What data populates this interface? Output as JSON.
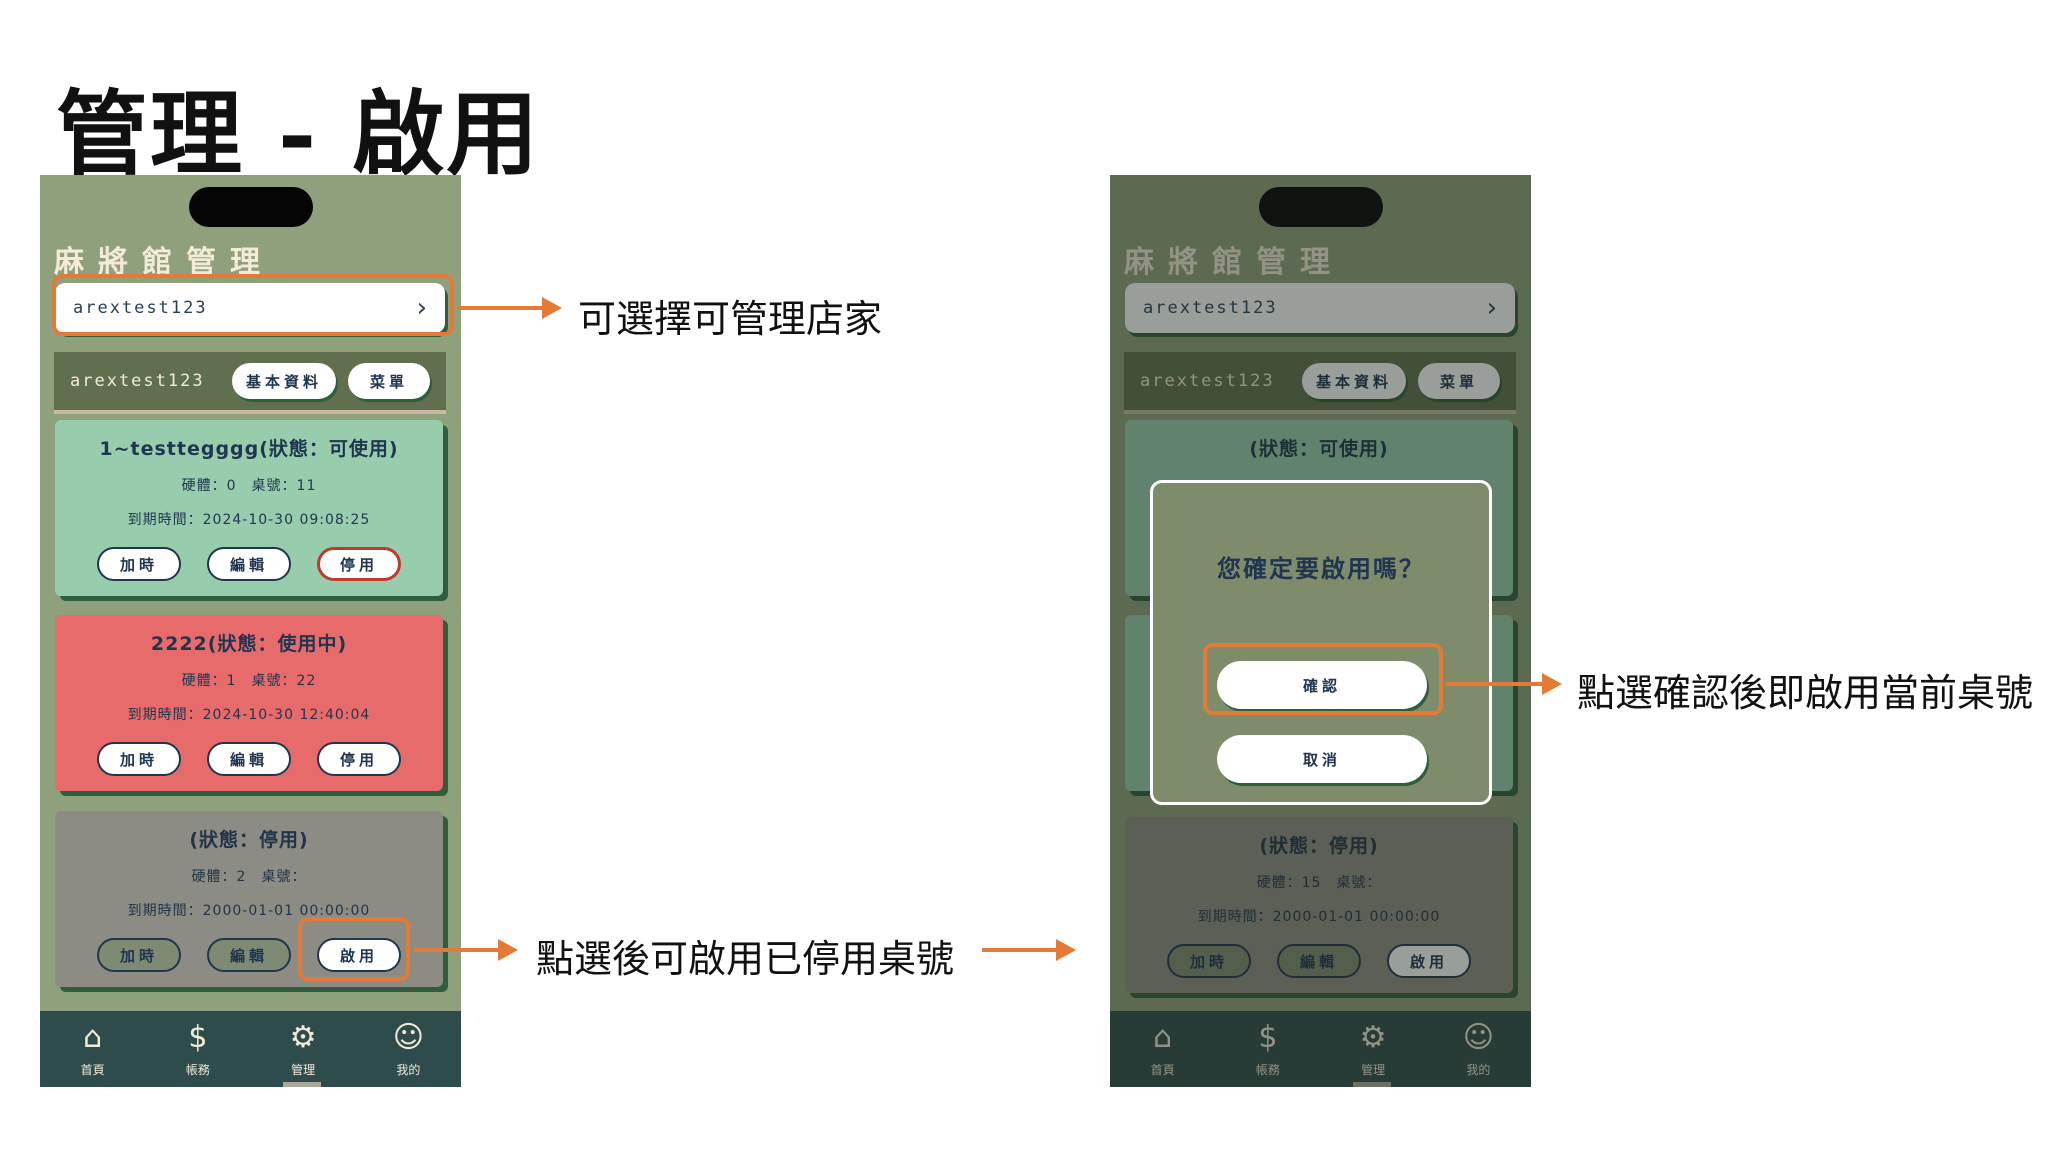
{
  "slide_title": "管理 - 啟用",
  "app_title": "麻將館管理",
  "shop_selector": {
    "value": "arextest123"
  },
  "store_bar": {
    "name": "arextest123",
    "basic_label": "基本資料",
    "menu_label": "菜單"
  },
  "tables": [
    {
      "heading": "1~testtegggg(狀態：可使用)",
      "hardware": "硬體：0　桌號：11",
      "expiry": "到期時間：2024-10-30 09:08:25",
      "buttons": [
        "加時",
        "編輯",
        "停用"
      ]
    },
    {
      "heading": "2222(狀態：使用中)",
      "hardware": "硬體：1　桌號：22",
      "expiry": "到期時間：2024-10-30 12:40:04",
      "buttons": [
        "加時",
        "編輯",
        "停用"
      ]
    },
    {
      "heading": "(狀態：停用)",
      "hardware": "硬體：2　桌號：",
      "expiry": "到期時間：2000-01-01 00:00:00",
      "buttons": [
        "加時",
        "編輯",
        "啟用"
      ]
    }
  ],
  "right_tables": [
    {
      "heading": "(狀態：可使用)"
    },
    {
      "heading": "(狀態：停用)",
      "hardware": "硬體：15　桌號：",
      "expiry": "到期時間：2000-01-01 00:00:00",
      "buttons": [
        "加時",
        "編輯",
        "啟用"
      ]
    }
  ],
  "modal": {
    "question": "您確定要啟用嗎？",
    "confirm": "確認",
    "cancel": "取消"
  },
  "tabbar": [
    {
      "icon": "house-icon",
      "label": "首頁"
    },
    {
      "icon": "money-bag-icon",
      "label": "帳務"
    },
    {
      "icon": "gear-icon",
      "label": "管理"
    },
    {
      "icon": "user-icon",
      "label": "我的"
    }
  ],
  "annotations": {
    "shop_select": "可選擇可管理店家",
    "enable_table": "點選後可啟用已停用桌號",
    "confirm_enable": "點選確認後即啟用當前桌號"
  },
  "colors": {
    "accent_orange": "#e37a35",
    "app_bg": "#8fa07c",
    "available": "#97ccac",
    "in_use": "#e76b6b",
    "disabled": "#8c8c84",
    "tabbar": "#2f4c4c"
  }
}
